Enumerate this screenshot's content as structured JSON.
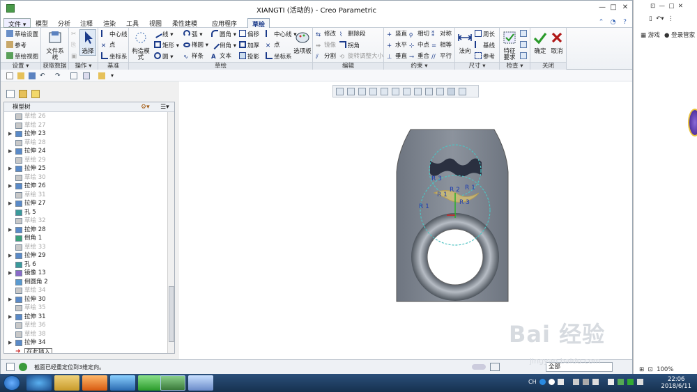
{
  "window": {
    "title": "XIANGTI (活动的) - Creo Parametric",
    "controls": [
      "—",
      "□",
      "✕"
    ]
  },
  "menu": {
    "file": "文件 ▾",
    "tabs": [
      "模型",
      "分析",
      "注释",
      "渲染",
      "工具",
      "视图",
      "柔性建模",
      "应用程序",
      "草绘"
    ],
    "active_tab": "草绘"
  },
  "ribbon": {
    "groups": {
      "settings": {
        "label": "设置 ▾",
        "items": [
          "草绘设置",
          "参考",
          "草绘视图"
        ]
      },
      "get_data": {
        "label": "获取数据",
        "big": "文件系统"
      },
      "operations": {
        "label": "操作 ▾",
        "big": "选择"
      },
      "datum": {
        "label": "基准",
        "items": [
          "中心线",
          "点",
          "坐标系"
        ]
      },
      "sketch": {
        "label": "草绘",
        "big": "构造模式",
        "items": [
          "线 ▾",
          "弧 ▾",
          "圆角 ▾",
          "偏移",
          "中心线 ▾",
          "矩形 ▾",
          "椭圆 ▾",
          "倒角 ▾",
          "加厚",
          "点",
          "圆 ▾",
          "样条",
          "文本",
          "投影",
          "坐标系"
        ],
        "palette": "选项板"
      },
      "edit": {
        "label": "编辑",
        "items": [
          "修改",
          "删除段",
          "镜像",
          "拐角",
          "分割",
          "旋转调整大小"
        ]
      },
      "constrain": {
        "label": "约束 ▾",
        "items": [
          "竖直",
          "相切",
          "对称",
          "水平",
          "中点",
          "相等",
          "垂直",
          "重合",
          "平行"
        ]
      },
      "dimension": {
        "label": "尺寸 ▾",
        "big": "法向",
        "items": [
          "周长",
          "基线",
          "参考"
        ]
      },
      "inspect": {
        "label": "检查 ▾",
        "big": "特征要求"
      },
      "close": {
        "label": "关闭",
        "ok": "确定",
        "cancel": "取消"
      }
    }
  },
  "model_tree": {
    "header": "模型树",
    "rows": [
      {
        "label": "草绘 26",
        "type": "sketch",
        "dim": true,
        "exp": false
      },
      {
        "label": "草绘 27",
        "type": "sketch",
        "dim": true,
        "exp": false
      },
      {
        "label": "拉伸 23",
        "type": "extrude",
        "dim": false,
        "exp": true
      },
      {
        "label": "草绘 28",
        "type": "sketch",
        "dim": true,
        "exp": false
      },
      {
        "label": "拉伸 24",
        "type": "extrude",
        "dim": false,
        "exp": true
      },
      {
        "label": "草绘 29",
        "type": "sketch",
        "dim": true,
        "exp": false
      },
      {
        "label": "拉伸 25",
        "type": "extrude",
        "dim": false,
        "exp": true
      },
      {
        "label": "草绘 30",
        "type": "sketch",
        "dim": true,
        "exp": false
      },
      {
        "label": "拉伸 26",
        "type": "extrude",
        "dim": false,
        "exp": true
      },
      {
        "label": "草绘 31",
        "type": "sketch",
        "dim": true,
        "exp": false
      },
      {
        "label": "拉伸 27",
        "type": "extrude",
        "dim": false,
        "exp": true
      },
      {
        "label": "孔 5",
        "type": "hole",
        "dim": false,
        "exp": false
      },
      {
        "label": "草绘 32",
        "type": "sketch",
        "dim": true,
        "exp": false
      },
      {
        "label": "拉伸 28",
        "type": "extrude",
        "dim": false,
        "exp": true
      },
      {
        "label": "倒角 1",
        "type": "chamfer",
        "dim": false,
        "exp": false
      },
      {
        "label": "草绘 33",
        "type": "sketch",
        "dim": true,
        "exp": false
      },
      {
        "label": "拉伸 29",
        "type": "extrude",
        "dim": false,
        "exp": true
      },
      {
        "label": "孔 6",
        "type": "hole",
        "dim": false,
        "exp": false
      },
      {
        "label": "镜像 13",
        "type": "mirror",
        "dim": false,
        "exp": true
      },
      {
        "label": "倒圆角 2",
        "type": "round",
        "dim": false,
        "exp": false
      },
      {
        "label": "草绘 34",
        "type": "sketch",
        "dim": true,
        "exp": false
      },
      {
        "label": "拉伸 30",
        "type": "extrude",
        "dim": false,
        "exp": true
      },
      {
        "label": "草绘 35",
        "type": "sketch",
        "dim": true,
        "exp": false
      },
      {
        "label": "拉伸 31",
        "type": "extrude",
        "dim": false,
        "exp": true
      },
      {
        "label": "草绘 36",
        "type": "sketch",
        "dim": true,
        "exp": false
      },
      {
        "label": "草绘 38",
        "type": "sketch",
        "dim": true,
        "exp": false
      },
      {
        "label": "拉伸 34",
        "type": "extrude",
        "dim": false,
        "exp": true
      },
      {
        "label": "在此插入",
        "type": "insert",
        "dim": false,
        "exp": false,
        "insert": true
      }
    ]
  },
  "canvas": {
    "dimensions": [
      "R 3",
      "R 1",
      "R 2",
      "R 1",
      "R 3",
      "R 1"
    ]
  },
  "status": {
    "message": "截面已经重定位到3维定向。",
    "filter": "全部"
  },
  "browser": {
    "games": "游戏",
    "login": "登录管家",
    "zoom": "100%"
  },
  "watermark": {
    "text": "Bai 经验",
    "sub": "jingyan.baidu.com"
  },
  "taskbar": {
    "lang": "CH",
    "time": "22:06",
    "date": "2018/6/11"
  }
}
